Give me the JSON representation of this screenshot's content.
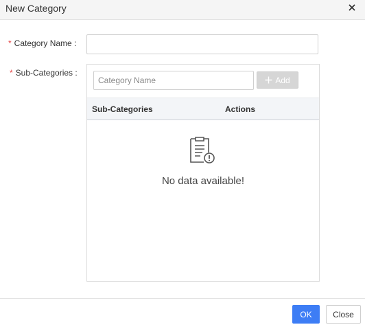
{
  "dialog": {
    "title": "New Category",
    "close_icon": "close-icon"
  },
  "form": {
    "category_name": {
      "required_mark": "*",
      "label": "Category Name :",
      "value": "",
      "placeholder": ""
    },
    "sub_categories": {
      "required_mark": "*",
      "label": "Sub-Categories :",
      "input": {
        "value": "",
        "placeholder": "Category Name"
      },
      "add_button": {
        "icon": "plus-icon",
        "label": "Add"
      },
      "table": {
        "columns": [
          "Sub-Categories",
          "Actions"
        ],
        "rows": [],
        "empty_icon": "clipboard-warning-icon",
        "empty_text": "No data available!"
      }
    }
  },
  "footer": {
    "ok_label": "OK",
    "close_label": "Close"
  },
  "colors": {
    "required": "#e54545",
    "primary": "#3d7df5",
    "disabled_button": "#d6d6d6",
    "table_header_bg": "#f3f5f8"
  }
}
